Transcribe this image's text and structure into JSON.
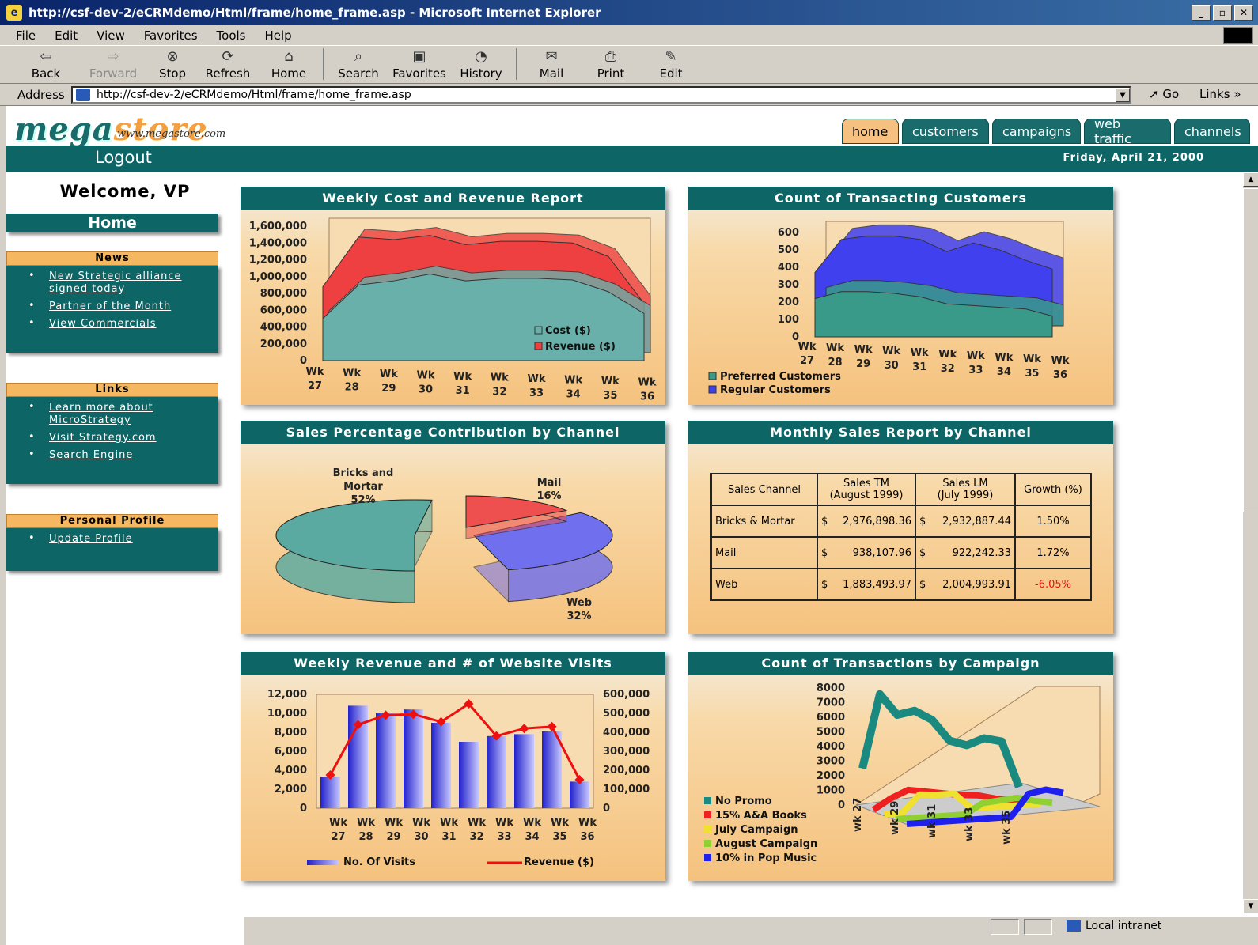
{
  "window": {
    "title": "http://csf-dev-2/eCRMdemo/Html/frame/home_frame.asp - Microsoft Internet Explorer",
    "min": "_",
    "max": "▫",
    "close": "✕"
  },
  "menu": [
    "File",
    "Edit",
    "View",
    "Favorites",
    "Tools",
    "Help"
  ],
  "toolbar": {
    "back": "Back",
    "forward": "Forward",
    "stop": "Stop",
    "refresh": "Refresh",
    "home": "Home",
    "search": "Search",
    "favorites": "Favorites",
    "history": "History",
    "mail": "Mail",
    "print": "Print",
    "edit": "Edit"
  },
  "address": {
    "label": "Address",
    "url": "http://csf-dev-2/eCRMdemo/Html/frame/home_frame.asp",
    "go": "Go",
    "links": "Links"
  },
  "site": {
    "logo_a": "mega",
    "logo_b": "store",
    "logo_sub": "www.megastore.com",
    "tabs": [
      "home",
      "customers",
      "campaigns",
      "web traffic",
      "channels"
    ],
    "logout": "Logout",
    "date": "Friday, April 21, 2000"
  },
  "sidebar": {
    "welcome": "Welcome, VP",
    "home": "Home",
    "news": {
      "title": "News",
      "items": [
        "New Strategic alliance signed today",
        "Partner of the Month",
        "View Commercials"
      ]
    },
    "links": {
      "title": "Links",
      "items": [
        "Learn more about MicroStrategy",
        "Visit Strategy.com",
        "Search Engine"
      ]
    },
    "profile": {
      "title": "Personal Profile",
      "items": [
        "Update Profile"
      ]
    }
  },
  "status": {
    "zone": "Local intranet"
  },
  "colors": {
    "teal": "#0d6565",
    "orange": "#f5c080"
  },
  "chart_data": [
    {
      "type": "area",
      "title": "Weekly Cost and Revenue Report",
      "x": [
        "Wk 27",
        "Wk 28",
        "Wk 29",
        "Wk 30",
        "Wk 31",
        "Wk 32",
        "Wk 33",
        "Wk 34",
        "Wk 35",
        "Wk 36"
      ],
      "ylim": [
        0,
        1600000
      ],
      "yticks": [
        "1,600,000",
        "1,400,000",
        "1,200,000",
        "1,000,000",
        "800,000",
        "600,000",
        "400,000",
        "200,000",
        "0"
      ],
      "series": [
        {
          "name": "Cost ($)",
          "values": [
            500000,
            900000,
            950000,
            1030000,
            950000,
            980000,
            980000,
            960000,
            820000,
            560000
          ],
          "color": "#6ab0aa"
        },
        {
          "name": "Revenue ($)",
          "values": [
            880000,
            1470000,
            1440000,
            1490000,
            1380000,
            1420000,
            1420000,
            1400000,
            1240000,
            680000
          ],
          "color": "#ee4040"
        }
      ]
    },
    {
      "type": "area",
      "title": "Count of Transacting Customers",
      "x": [
        "Wk 27",
        "Wk 28",
        "Wk 29",
        "Wk 30",
        "Wk 31",
        "Wk 32",
        "Wk 33",
        "Wk 34",
        "Wk 35",
        "Wk 36"
      ],
      "ylim": [
        0,
        600
      ],
      "yticks": [
        "600",
        "500",
        "400",
        "300",
        "200",
        "100",
        "0"
      ],
      "series": [
        {
          "name": "Preferred Customers",
          "values": [
            220,
            260,
            260,
            250,
            230,
            190,
            180,
            170,
            160,
            120
          ],
          "color": "#3a9a8a"
        },
        {
          "name": "Regular Customers",
          "values": [
            370,
            560,
            580,
            580,
            560,
            490,
            540,
            500,
            440,
            390
          ],
          "color": "#4040ee"
        }
      ]
    },
    {
      "type": "pie",
      "title": "Sales Percentage Contribution by Channel",
      "labels": [
        "Bricks and Mortar",
        "Mail",
        "Web"
      ],
      "percents": [
        "52%",
        "16%",
        "32%"
      ],
      "values": [
        52,
        16,
        32
      ],
      "colors": [
        "#5aaaa2",
        "#ee5050",
        "#7070ee"
      ]
    },
    {
      "type": "table",
      "title": "Monthly Sales Report by Channel",
      "headers": [
        "Sales Channel",
        "Sales TM (August 1999)",
        "Sales LM (July 1999)",
        "Growth (%)"
      ],
      "header_top": [
        "Sales Channel",
        "Sales TM",
        "Sales LM",
        "Growth (%)"
      ],
      "header_sub": [
        "",
        "(August 1999)",
        "(July 1999)",
        ""
      ],
      "rows": [
        [
          "Bricks & Mortar",
          "$",
          "2,976,898.36",
          "$",
          "2,932,887.44",
          "1.50%"
        ],
        [
          "Mail",
          "$",
          "938,107.96",
          "$",
          "922,242.33",
          "1.72%"
        ],
        [
          "Web",
          "$",
          "1,883,493.97",
          "$",
          "2,004,993.91",
          "-6.05%"
        ]
      ]
    },
    {
      "type": "bar",
      "title": "Weekly Revenue and # of Website Visits",
      "x": [
        "Wk 27",
        "Wk 28",
        "Wk 29",
        "Wk 30",
        "Wk 31",
        "Wk 32",
        "Wk 33",
        "Wk 34",
        "Wk 35",
        "Wk 36"
      ],
      "ylim": [
        0,
        12000
      ],
      "yticks": [
        "12,000",
        "10,000",
        "8,000",
        "6,000",
        "4,000",
        "2,000",
        "0"
      ],
      "y2lim": [
        0,
        600000
      ],
      "y2ticks": [
        "600,000",
        "500,000",
        "400,000",
        "300,000",
        "200,000",
        "100,000",
        "0"
      ],
      "series": [
        {
          "name": "No. Of Visits",
          "values": [
            3300,
            10800,
            10000,
            10400,
            9000,
            7000,
            7600,
            7800,
            8100,
            2800
          ],
          "color": "#4a4aee"
        },
        {
          "name": "Revenue ($)",
          "values": [
            175000,
            440000,
            490000,
            495000,
            455000,
            550000,
            380000,
            420000,
            430000,
            150000
          ],
          "color": "#ee1010"
        }
      ]
    },
    {
      "type": "line",
      "title": "Count of Transactions by Campaign",
      "x": [
        "wk 27",
        "wk 29",
        "wk 31",
        "wk 33",
        "wk 35"
      ],
      "ylim": [
        0,
        8000
      ],
      "yticks": [
        "8000",
        "7000",
        "6000",
        "5000",
        "4000",
        "3000",
        "2000",
        "1000",
        "0"
      ],
      "series": [
        {
          "name": "No Promo",
          "values": [
            2500,
            7500,
            6000,
            6200,
            5500,
            4000,
            3600,
            4000,
            3700,
            500
          ],
          "color": "#1a8a80"
        },
        {
          "name": "15% A&A Books",
          "values": [
            0,
            700,
            1200,
            1000,
            800,
            600,
            500,
            200,
            0,
            0
          ],
          "color": "#ee2020"
        },
        {
          "name": "July Campaign",
          "values": [
            0,
            0,
            1200,
            1100,
            1100,
            0,
            0,
            0,
            0,
            0
          ],
          "color": "#f0e030"
        },
        {
          "name": "August Campaign",
          "values": [
            0,
            0,
            0,
            0,
            0,
            700,
            800,
            900,
            600,
            400
          ],
          "color": "#90d030"
        },
        {
          "name": "10% in Pop Music",
          "values": [
            0,
            0,
            0,
            0,
            0,
            0,
            0,
            1500,
            1700,
            1400
          ],
          "color": "#2020ee"
        }
      ]
    }
  ]
}
